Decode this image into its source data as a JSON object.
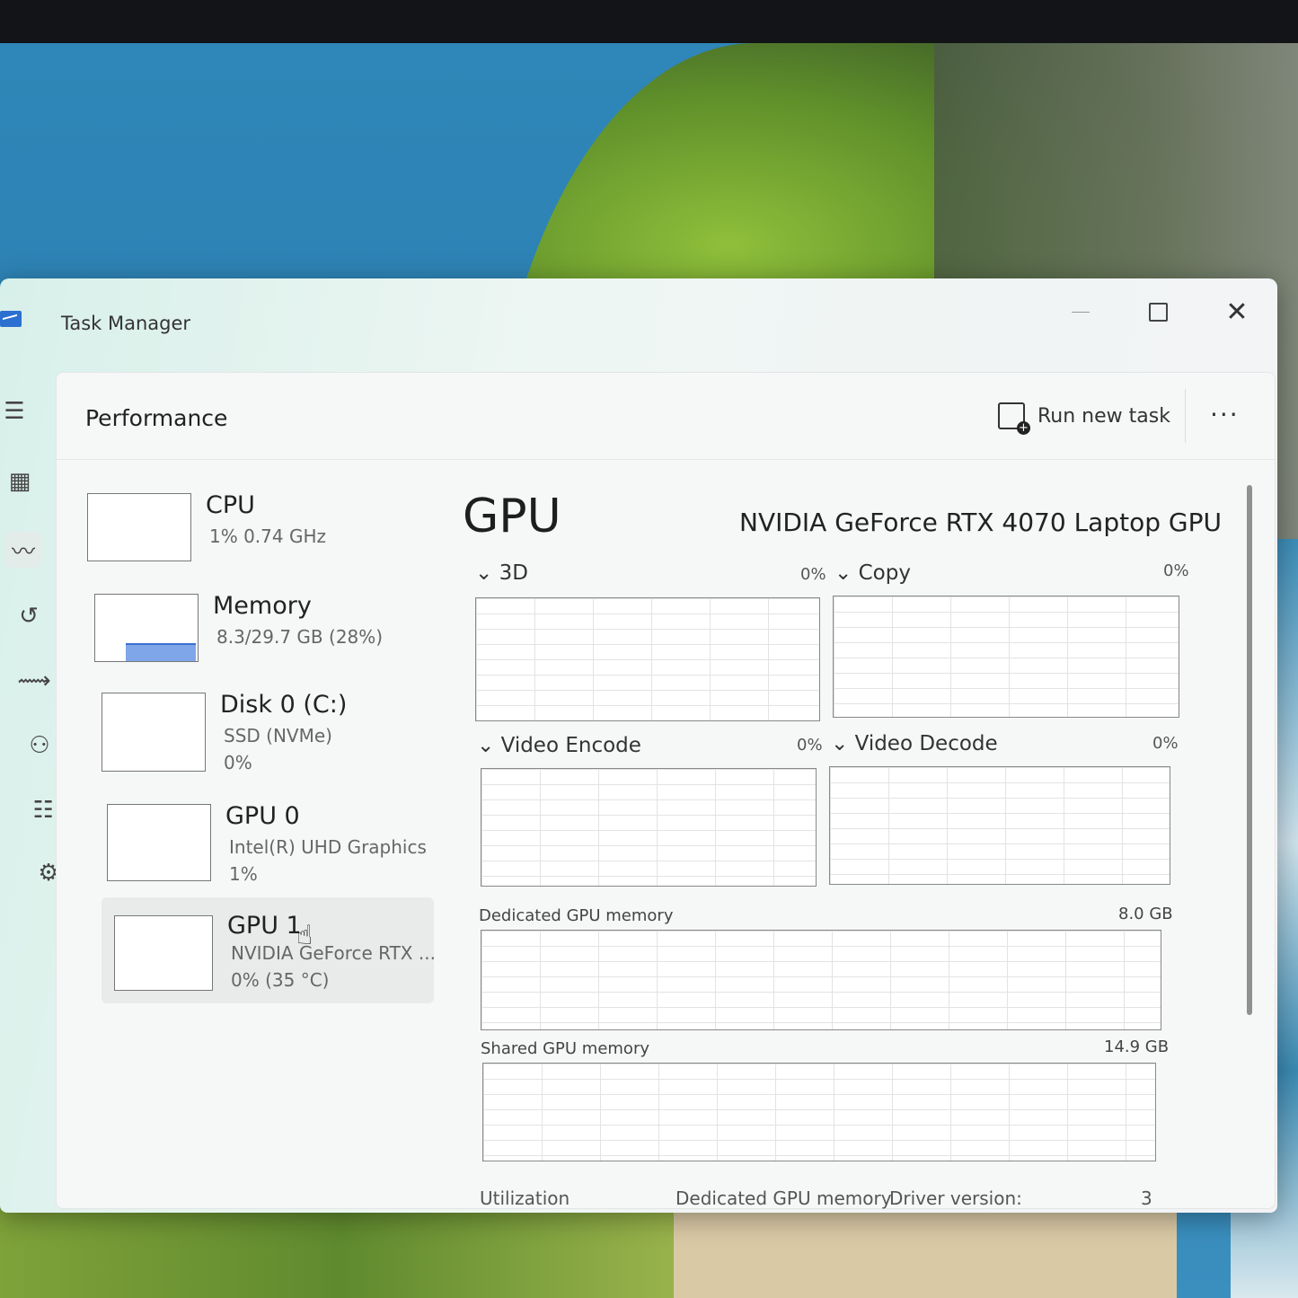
{
  "window": {
    "title": "Task Manager"
  },
  "header": {
    "page_title": "Performance",
    "run_new_task": "Run new task",
    "more_label": "···"
  },
  "rail": [
    {
      "icon": "hamburger-icon",
      "glyph": "☰"
    },
    {
      "icon": "processes-icon",
      "glyph": "▦"
    },
    {
      "icon": "performance-icon",
      "glyph": "〰"
    },
    {
      "icon": "app-history-icon",
      "glyph": "↺"
    },
    {
      "icon": "startup-apps-icon",
      "glyph": "⟿"
    },
    {
      "icon": "users-icon",
      "glyph": "⚇"
    },
    {
      "icon": "details-icon",
      "glyph": "☷"
    },
    {
      "icon": "services-icon",
      "glyph": "⚙"
    },
    {
      "icon": "settings-icon",
      "glyph": "⚙"
    }
  ],
  "devices": [
    {
      "name": "CPU",
      "line1": "1%  0.74 GHz",
      "line2": ""
    },
    {
      "name": "Memory",
      "line1": "8.3/29.7 GB (28%)",
      "line2": "",
      "usage": 0.28
    },
    {
      "name": "Disk 0 (C:)",
      "line1": "SSD (NVMe)",
      "line2": "0%"
    },
    {
      "name": "GPU 0",
      "line1": "Intel(R) UHD Graphics",
      "line2": "1%"
    },
    {
      "name": "GPU 1",
      "line1": "NVIDIA GeForce RTX ...",
      "line2": "0%  (35 °C)"
    }
  ],
  "gpu": {
    "title": "GPU",
    "model": "NVIDIA GeForce RTX 4070 Laptop GPU",
    "engines": [
      {
        "label": "3D",
        "pct": "0%"
      },
      {
        "label": "Copy",
        "pct": "0%"
      },
      {
        "label": "Video Encode",
        "pct": "0%"
      },
      {
        "label": "Video Decode",
        "pct": "0%"
      }
    ],
    "dedicated_memory": {
      "label": "Dedicated GPU memory",
      "max": "8.0 GB"
    },
    "shared_memory": {
      "label": "Shared GPU memory",
      "max": "14.9 GB"
    },
    "stats": {
      "utilization": "Utilization",
      "dedicated": "Dedicated GPU memory",
      "driver": "Driver version:",
      "driver_value": "3"
    }
  }
}
